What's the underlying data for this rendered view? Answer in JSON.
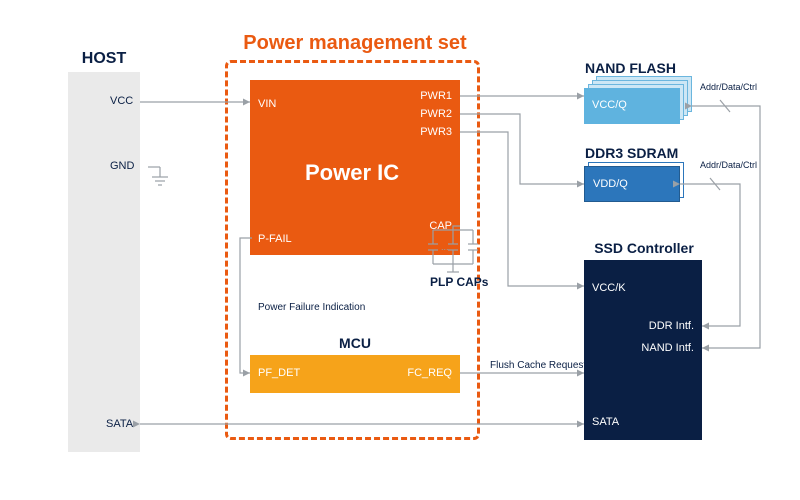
{
  "title": "Power management set",
  "host": {
    "title": "HOST",
    "vcc": "VCC",
    "gnd": "GND",
    "sata": "SATA"
  },
  "power_ic": {
    "title": "Power IC",
    "vin": "VIN",
    "pwr1": "PWR1",
    "pwr2": "PWR2",
    "pwr3": "PWR3",
    "cap": "CAP",
    "pfail": "P-FAIL"
  },
  "mcu": {
    "title": "MCU",
    "pf_det": "PF_DET",
    "fc_req": "FC_REQ"
  },
  "signals": {
    "pfi": "Power Failure Indication",
    "fcr": "Flush Cache Request"
  },
  "plp": {
    "label": "PLP CAPs"
  },
  "nand": {
    "title": "NAND FLASH",
    "pin": "VCC/Q",
    "bus": "Addr/Data/Ctrl"
  },
  "ddr": {
    "title": "DDR3 SDRAM",
    "pin": "VDD/Q",
    "bus": "Addr/Data/Ctrl"
  },
  "ssd": {
    "title": "SSD Controller",
    "vcck": "VCC/K",
    "ddr_if": "DDR Intf.",
    "nand_if": "NAND Intf.",
    "sata": "SATA"
  }
}
